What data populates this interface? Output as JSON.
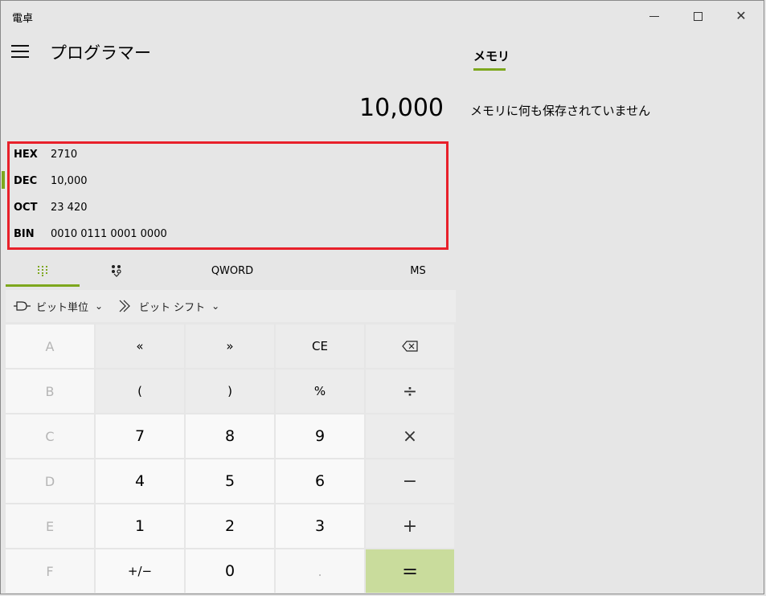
{
  "window": {
    "title": "電卓",
    "minimize_glyph": "",
    "close_glyph": "✕"
  },
  "header": {
    "menu_icon": "hamburger-icon",
    "mode_title": "プログラマー"
  },
  "display": {
    "value": "10,000"
  },
  "radix": [
    {
      "label": "HEX",
      "value": "2710"
    },
    {
      "label": "DEC",
      "value": "10,000",
      "selected": true
    },
    {
      "label": "OCT",
      "value": "23 420"
    },
    {
      "label": "BIN",
      "value": "0010 0111 0001 0000"
    }
  ],
  "tabs": {
    "keypad_icon": "full-keypad-icon",
    "bit_toggle_icon": "bit-toggle-icon",
    "word_size": "QWORD",
    "memory_store": "MS"
  },
  "bit_ops": {
    "bitwise_label": "ビット単位",
    "shift_label": "ビット シフト",
    "chevron": "⌄"
  },
  "keys": [
    [
      "A",
      "«",
      "»",
      "CE",
      "⌫"
    ],
    [
      "B",
      "(",
      ")",
      "%",
      "÷"
    ],
    [
      "C",
      "7",
      "8",
      "9",
      "×"
    ],
    [
      "D",
      "4",
      "5",
      "6",
      "−"
    ],
    [
      "E",
      "1",
      "2",
      "3",
      "+"
    ],
    [
      "F",
      "+/−",
      "0",
      ".",
      "="
    ]
  ],
  "memory": {
    "tab_label": "メモリ",
    "empty_message": "メモリに何も保存されていません"
  },
  "colors": {
    "accent": "#7da71d",
    "equals_bg": "#c9dc9c",
    "highlight_border": "#e8202a"
  }
}
